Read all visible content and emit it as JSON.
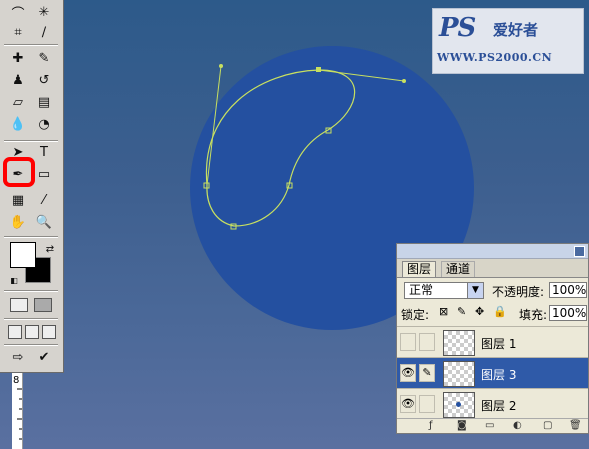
{
  "watermark": {
    "logo": "PS",
    "text": "爱好者",
    "url": "WWW.PS2000.CN"
  },
  "toolbox": {
    "tools": [
      {
        "name": "lasso-tool",
        "glyph": "⌒"
      },
      {
        "name": "magic-wand-tool",
        "glyph": "✳"
      },
      {
        "name": "crop-tool",
        "glyph": "⌗"
      },
      {
        "name": "slice-tool",
        "glyph": "∕"
      },
      {
        "name": "healing-brush-tool",
        "glyph": "✚"
      },
      {
        "name": "brush-tool",
        "glyph": "✎"
      },
      {
        "name": "clone-stamp-tool",
        "glyph": "♟"
      },
      {
        "name": "history-brush-tool",
        "glyph": "↺"
      },
      {
        "name": "eraser-tool",
        "glyph": "▱"
      },
      {
        "name": "gradient-tool",
        "glyph": "▤"
      },
      {
        "name": "blur-tool",
        "glyph": "💧"
      },
      {
        "name": "dodge-tool",
        "glyph": "◔"
      },
      {
        "name": "path-selection-tool",
        "glyph": "➤"
      },
      {
        "name": "type-tool",
        "glyph": "T"
      },
      {
        "name": "pen-tool",
        "glyph": "✒"
      },
      {
        "name": "shape-tool",
        "glyph": "▭"
      },
      {
        "name": "notes-tool",
        "glyph": "▦"
      },
      {
        "name": "eyedropper-tool",
        "glyph": "⁄"
      },
      {
        "name": "hand-tool",
        "glyph": "✋"
      },
      {
        "name": "zoom-tool",
        "glyph": "🔍"
      }
    ]
  },
  "ruler": {
    "mark": "8"
  },
  "layers_panel": {
    "tabs": [
      "图层",
      "通道"
    ],
    "blend_mode": "正常",
    "opacity_label": "不透明度:",
    "opacity_value": "100%",
    "lock_label": "锁定:",
    "fill_label": "填充:",
    "fill_value": "100%",
    "layers": [
      {
        "name": "图层 1",
        "visible": false,
        "selected": false
      },
      {
        "name": "图层 3",
        "visible": true,
        "selected": true
      },
      {
        "name": "图层 2",
        "visible": true,
        "selected": false
      }
    ]
  },
  "colors": {
    "canvas_top": "#2d5a8a",
    "circle": "#2450a0",
    "path": "#c8e060",
    "highlight": "#ff0000",
    "selected_layer": "#2f5aa8"
  }
}
